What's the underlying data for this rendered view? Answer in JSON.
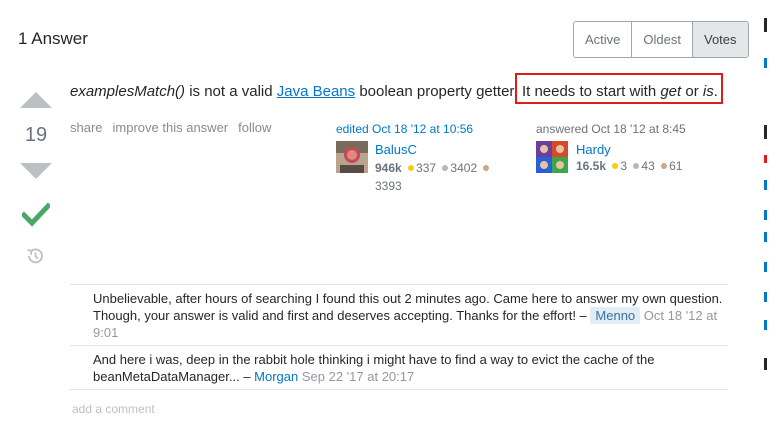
{
  "header": {
    "title": "1 Answer"
  },
  "sort_tabs": [
    {
      "label": "Active",
      "selected": false
    },
    {
      "label": "Oldest",
      "selected": false
    },
    {
      "label": "Votes",
      "selected": true
    }
  ],
  "vote": {
    "count": "19"
  },
  "answer": {
    "part1_code": "examplesMatch()",
    "part2": " is not a valid ",
    "link_text": "Java Beans",
    "part3": " boolean property getter. ",
    "part4": "It needs to start with ",
    "em1": "get",
    "part5": " or ",
    "em2": "is",
    "part6": "."
  },
  "post_menu": {
    "share": "share",
    "improve": "improve this answer",
    "follow": "follow"
  },
  "editor": {
    "action": "edited Oct 18 '12 at 10:56",
    "name": "BalusC",
    "rep": "946k",
    "gold": "337",
    "silver": "3402",
    "bronze": "3393"
  },
  "author": {
    "action": "answered Oct 18 '12 at 8:45",
    "name": "Hardy",
    "rep": "16.5k",
    "gold": "3",
    "silver": "43",
    "bronze": "61"
  },
  "comments": [
    {
      "text": "Unbelievable, after hours of searching I found this out 2 minutes ago. Came here to answer my own question. Though, your answer is valid and first and deserves accepting. Thanks for the effort! – ",
      "user": "Menno",
      "date": "Oct 18 '12 at 9:01"
    },
    {
      "text": "And here i was, deep in the rabbit hole thinking i might have to find a way to evict the cache of the beanMetaDataManager... – ",
      "user": "Morgan",
      "date": "Sep 22 '17 at 20:17"
    }
  ],
  "add_comment": "add a comment",
  "colors": {
    "accent_link": "#0077cc",
    "highlight_border": "#e01b1b",
    "accepted": "#48a868"
  }
}
